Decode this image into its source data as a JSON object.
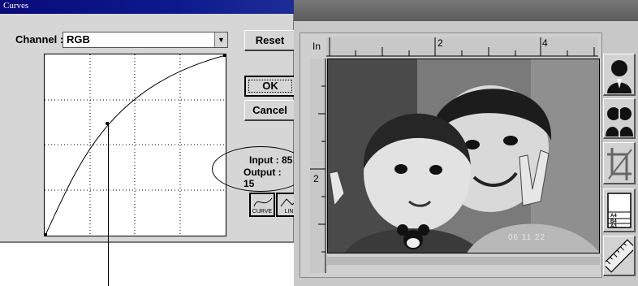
{
  "curves_dialog": {
    "title": "Curves",
    "channel_label": "Channel :",
    "channel_value": "RGB",
    "buttons": {
      "reset": "Reset",
      "ok": "OK",
      "cancel": "Cancel"
    },
    "input_readout": "Input : 85",
    "output_readout": "Output : 15",
    "mode_buttons": {
      "curve": "CURVE",
      "linear": "LIN"
    }
  },
  "preview_window": {
    "ruler_unit": "In",
    "ruler_top_labels": [
      "2",
      "4"
    ],
    "ruler_left_labels": [
      "2"
    ],
    "photo_timestamp": "06 11 22",
    "toolbar_icons": [
      "portrait-icon",
      "mirror-portrait-icon",
      "crop-icon",
      "paper-size-icon",
      "ruler-icon"
    ],
    "paper_sizes": [
      "A4",
      "B4",
      "A3"
    ]
  }
}
